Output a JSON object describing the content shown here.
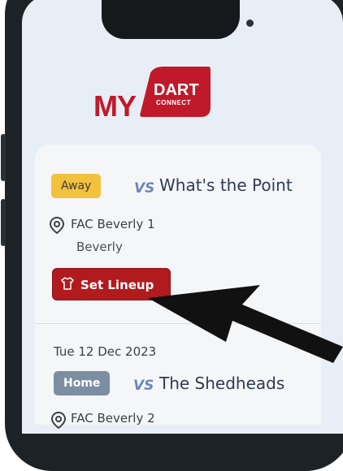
{
  "logo": {
    "my": "MY",
    "dart": "DART",
    "connect": "CONNECT"
  },
  "matches": [
    {
      "badge": "Away",
      "vs_icon": "vs-icon",
      "opponent": "What's the Point",
      "venue": "FAC Beverly 1",
      "city": "Beverly",
      "action_label": "Set Lineup"
    },
    {
      "date": "Tue 12 Dec 2023",
      "badge": "Home",
      "vs_icon": "vs-icon",
      "opponent": "The Shedheads",
      "venue": "FAC Beverly 2"
    }
  ],
  "colors": {
    "brand_red": "#c01a2a",
    "button_red": "#b11b1e",
    "away_badge": "#f2c23d",
    "home_badge": "#7b8ea2",
    "team_text": "#2f3b53"
  },
  "annotation": {
    "icon": "arrow-pointer-icon"
  }
}
